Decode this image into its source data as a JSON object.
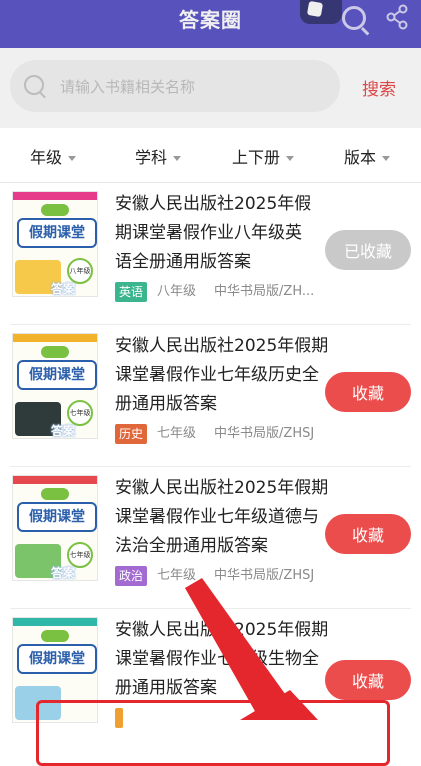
{
  "header": {
    "title": "答案圈"
  },
  "search": {
    "placeholder": "请输入书籍相关名称",
    "value": "",
    "button_label": "搜索"
  },
  "filters": [
    {
      "label": "年级"
    },
    {
      "label": "学科"
    },
    {
      "label": "上下册"
    },
    {
      "label": "版本"
    }
  ],
  "books": [
    {
      "title": "安徽人民出版社2025年假期课堂暑假作业八年级英语全册通用版答案",
      "subject": "英语",
      "subject_color": "#3bb58e",
      "grade": "八年级",
      "publisher": "中华书局版/ZH...",
      "button": "已收藏",
      "button_color": "#c9c9c9",
      "cover_band_color": "#e63a8a",
      "cover_logo": "假期课堂"
    },
    {
      "title": "安徽人民出版社2025年假期课堂暑假作业七年级历史全册通用版答案",
      "subject": "历史",
      "subject_color": "#e0673a",
      "grade": "七年级",
      "publisher": "中华书局版/ZHSJ",
      "button": "收藏",
      "button_color": "#eb4c4c",
      "cover_band_color": "#f2b32a",
      "cover_logo": "假期课堂"
    },
    {
      "title": "安徽人民出版社2025年假期课堂暑假作业七年级道德与法治全册通用版答案",
      "subject": "政治",
      "subject_color": "#a36bd1",
      "grade": "七年级",
      "publisher": "中华书局版/ZHSJ",
      "button": "收藏",
      "button_color": "#eb4c4c",
      "cover_band_color": "#e5484d",
      "cover_logo": "假期课堂"
    },
    {
      "title": "安徽人民出版社2025年假期课堂暑假作业七年级生物全册通用版答案",
      "subject": "",
      "subject_color": "#f0a030",
      "grade": "",
      "publisher": "",
      "button": "收藏",
      "button_color": "#eb4c4c",
      "cover_band_color": "#2fb7a7",
      "cover_logo": "假期课堂"
    }
  ]
}
